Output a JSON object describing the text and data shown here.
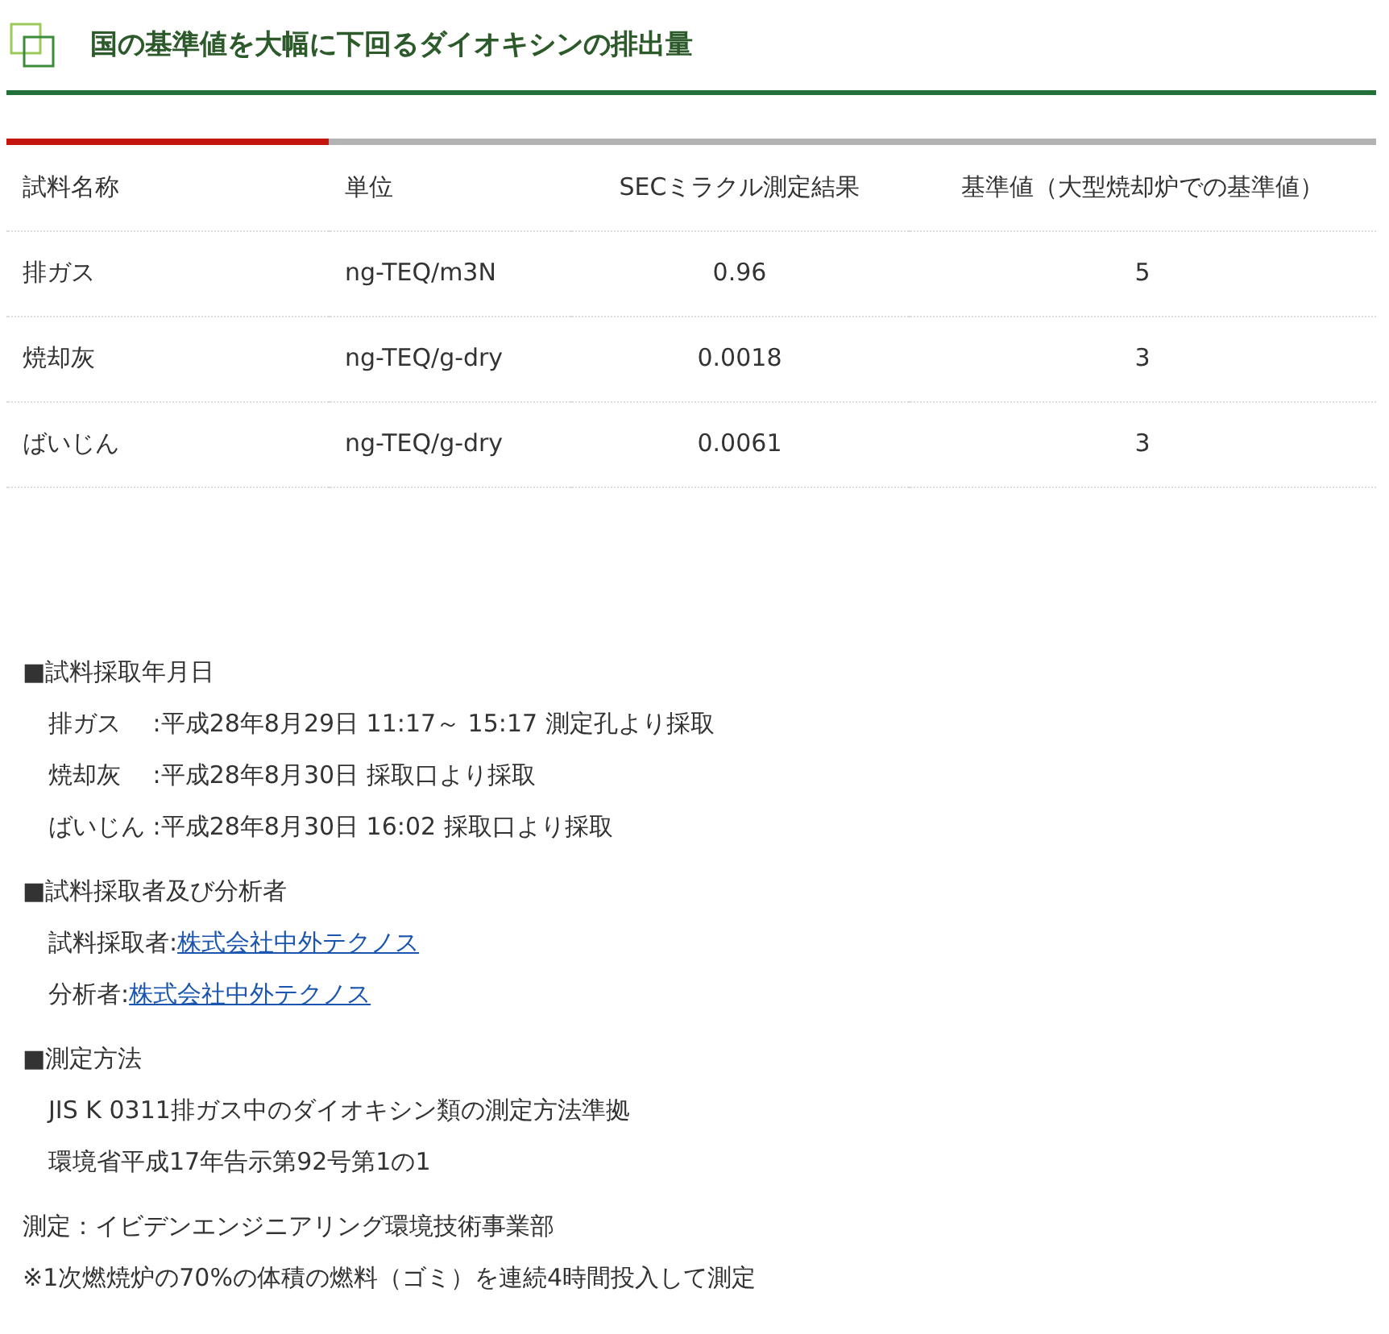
{
  "title": "国の基準値を大幅に下回るダイオキシンの排出量",
  "table": {
    "columns": [
      "試料名称",
      "単位",
      "SECミラクル測定結果",
      "基準値（大型焼却炉での基準値）"
    ],
    "rows": [
      [
        "排ガス",
        "ng-TEQ/m3N",
        "0.96",
        "5"
      ],
      [
        "焼却灰",
        "ng-TEQ/g-dry",
        "0.0018",
        "3"
      ],
      [
        "ばいじん",
        "ng-TEQ/g-dry",
        "0.0061",
        "3"
      ]
    ]
  },
  "sections": [
    {
      "heading": "■試料採取年月日",
      "lines": [
        {
          "kind": "text",
          "text": "排ガス　 :平成28年8月29日 11:17～ 15:17 測定孔より採取"
        },
        {
          "kind": "text",
          "text": "焼却灰　 :平成28年8月30日 採取口より採取"
        },
        {
          "kind": "text",
          "text": "ばいじん :平成28年8月30日 16:02 採取口より採取"
        }
      ]
    },
    {
      "heading": "■試料採取者及び分析者",
      "lines": [
        {
          "kind": "link",
          "text": "試料採取者:",
          "link": "株式会社中外テクノス"
        },
        {
          "kind": "link",
          "text": "分析者:",
          "link": "株式会社中外テクノス"
        }
      ]
    },
    {
      "heading": "■測定方法",
      "lines": [
        {
          "kind": "text",
          "text": "JIS K 0311排ガス中のダイオキシン類の測定方法準拠"
        },
        {
          "kind": "text",
          "text": "環境省平成17年告示第92号第1の1"
        }
      ]
    }
  ],
  "notes": [
    "測定：イビデンエンジニアリング環境技術事業部",
    "※1次燃焼炉の70%の体積の燃料（ゴミ）を連続4時間投入して測定"
  ]
}
